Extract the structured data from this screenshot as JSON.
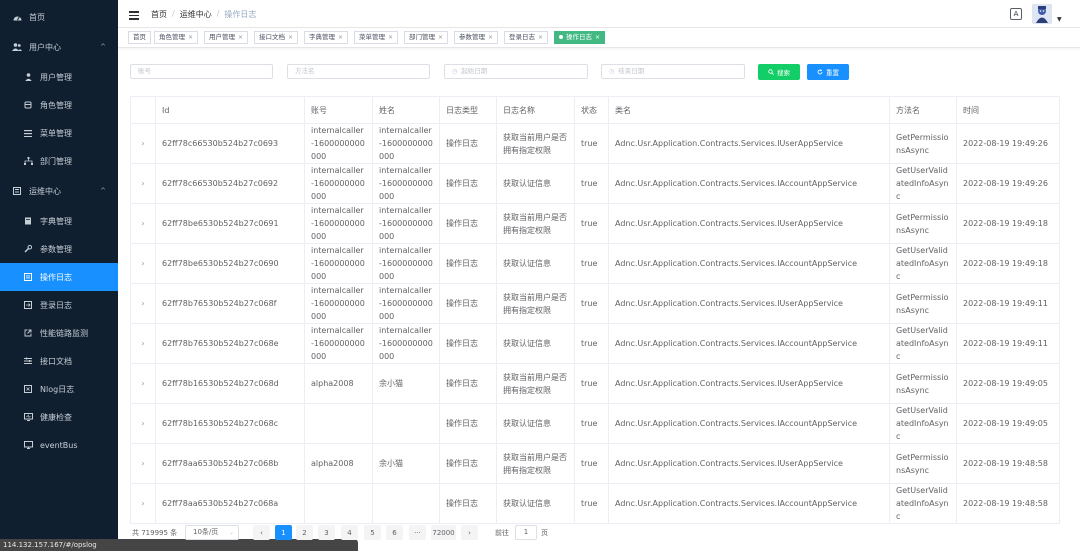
{
  "sidebar": {
    "items": [
      {
        "label": "首页",
        "icon": "dashboard-icon"
      },
      {
        "label": "用户中心",
        "icon": "users-icon"
      },
      {
        "label": "用户管理",
        "icon": "user-icon"
      },
      {
        "label": "角色管理",
        "icon": "role-icon"
      },
      {
        "label": "菜单管理",
        "icon": "menu-list-icon"
      },
      {
        "label": "部门管理",
        "icon": "tree-icon"
      },
      {
        "label": "运维中心",
        "icon": "ops-icon"
      },
      {
        "label": "字典管理",
        "icon": "dict-icon"
      },
      {
        "label": "参数管理",
        "icon": "wrench-icon"
      },
      {
        "label": "操作日志",
        "icon": "log-icon"
      },
      {
        "label": "登录日志",
        "icon": "login-log-icon"
      },
      {
        "label": "性能链路监测",
        "icon": "external-link-icon"
      },
      {
        "label": "接口文档",
        "icon": "api-doc-icon"
      },
      {
        "label": "Nlog日志",
        "icon": "nlog-icon"
      },
      {
        "label": "健康检查",
        "icon": "monitor-icon"
      },
      {
        "label": "eventBus",
        "icon": "desktop-icon"
      }
    ],
    "active": "操作日志"
  },
  "status_url": "114.132.157.167/#/opslog",
  "header": {
    "breadcrumb": [
      "首页",
      "运维中心",
      "操作日志"
    ],
    "lang_label": "A"
  },
  "tags": [
    "首页",
    "角色管理",
    "用户管理",
    "接口文档",
    "字典管理",
    "菜单管理",
    "部门管理",
    "参数管理",
    "登录日志",
    "操作日志"
  ],
  "active_tag": "操作日志",
  "search": {
    "account_placeholder": "账号",
    "method_placeholder": "方法名",
    "start_placeholder": "起始日期",
    "end_placeholder": "结束日期",
    "search_label": "搜索",
    "reset_label": "重置"
  },
  "table": {
    "columns": [
      "Id",
      "账号",
      "姓名",
      "日志类型",
      "日志名称",
      "状态",
      "类名",
      "方法名",
      "时间"
    ],
    "rows": [
      {
        "id": "62ff78c66530b524b27c0693",
        "account": "internalcaller-1600000000000",
        "name": "internalcaller-1600000000000",
        "type": "操作日志",
        "logname": "获取当前用户是否拥有指定权限",
        "status": "true",
        "cls": "Adnc.Usr.Application.Contracts.Services.IUserAppService",
        "method": "GetPermissionsAsync",
        "time": "2022-08-19 19:49:26"
      },
      {
        "id": "62ff78c66530b524b27c0692",
        "account": "internalcaller-1600000000000",
        "name": "internalcaller-1600000000000",
        "type": "操作日志",
        "logname": "获取认证信息",
        "status": "true",
        "cls": "Adnc.Usr.Application.Contracts.Services.IAccountAppService",
        "method": "GetUserValidatedInfoAsync",
        "time": "2022-08-19 19:49:26"
      },
      {
        "id": "62ff78be6530b524b27c0691",
        "account": "internalcaller-1600000000000",
        "name": "internalcaller-1600000000000",
        "type": "操作日志",
        "logname": "获取当前用户是否拥有指定权限",
        "status": "true",
        "cls": "Adnc.Usr.Application.Contracts.Services.IUserAppService",
        "method": "GetPermissionsAsync",
        "time": "2022-08-19 19:49:18"
      },
      {
        "id": "62ff78be6530b524b27c0690",
        "account": "internalcaller-1600000000000",
        "name": "internalcaller-1600000000000",
        "type": "操作日志",
        "logname": "获取认证信息",
        "status": "true",
        "cls": "Adnc.Usr.Application.Contracts.Services.IAccountAppService",
        "method": "GetUserValidatedInfoAsync",
        "time": "2022-08-19 19:49:18"
      },
      {
        "id": "62ff78b76530b524b27c068f",
        "account": "internalcaller-1600000000000",
        "name": "internalcaller-1600000000000",
        "type": "操作日志",
        "logname": "获取当前用户是否拥有指定权限",
        "status": "true",
        "cls": "Adnc.Usr.Application.Contracts.Services.IUserAppService",
        "method": "GetPermissionsAsync",
        "time": "2022-08-19 19:49:11"
      },
      {
        "id": "62ff78b76530b524b27c068e",
        "account": "internalcaller-1600000000000",
        "name": "internalcaller-1600000000000",
        "type": "操作日志",
        "logname": "获取认证信息",
        "status": "true",
        "cls": "Adnc.Usr.Application.Contracts.Services.IAccountAppService",
        "method": "GetUserValidatedInfoAsync",
        "time": "2022-08-19 19:49:11"
      },
      {
        "id": "62ff78b16530b524b27c068d",
        "account": "alpha2008",
        "name": "余小猫",
        "type": "操作日志",
        "logname": "获取当前用户是否拥有指定权限",
        "status": "true",
        "cls": "Adnc.Usr.Application.Contracts.Services.IUserAppService",
        "method": "GetPermissionsAsync",
        "time": "2022-08-19 19:49:05"
      },
      {
        "id": "62ff78b16530b524b27c068c",
        "account": "",
        "name": "",
        "type": "操作日志",
        "logname": "获取认证信息",
        "status": "true",
        "cls": "Adnc.Usr.Application.Contracts.Services.IAccountAppService",
        "method": "GetUserValidatedInfoAsync",
        "time": "2022-08-19 19:49:05"
      },
      {
        "id": "62ff78aa6530b524b27c068b",
        "account": "alpha2008",
        "name": "余小猫",
        "type": "操作日志",
        "logname": "获取当前用户是否拥有指定权限",
        "status": "true",
        "cls": "Adnc.Usr.Application.Contracts.Services.IUserAppService",
        "method": "GetPermissionsAsync",
        "time": "2022-08-19 19:48:58"
      },
      {
        "id": "62ff78aa6530b524b27c068a",
        "account": "",
        "name": "",
        "type": "操作日志",
        "logname": "获取认证信息",
        "status": "true",
        "cls": "Adnc.Usr.Application.Contracts.Services.IAccountAppService",
        "method": "GetUserValidatedInfoAsync",
        "time": "2022-08-19 19:48:58"
      }
    ]
  },
  "pagination": {
    "total_label": "共 719995 条",
    "page_size_label": "10条/页",
    "pages": [
      "1",
      "2",
      "3",
      "4",
      "5",
      "6",
      "···",
      "72000"
    ],
    "current_page": "1",
    "goto_label": "前往",
    "goto_value": "1",
    "page_suffix": "页"
  },
  "colors": {
    "sidebar_bg": "#0f1f30",
    "active_blue": "#1890ff",
    "active_tag_green": "#42b983",
    "search_green": "#13ce66"
  }
}
